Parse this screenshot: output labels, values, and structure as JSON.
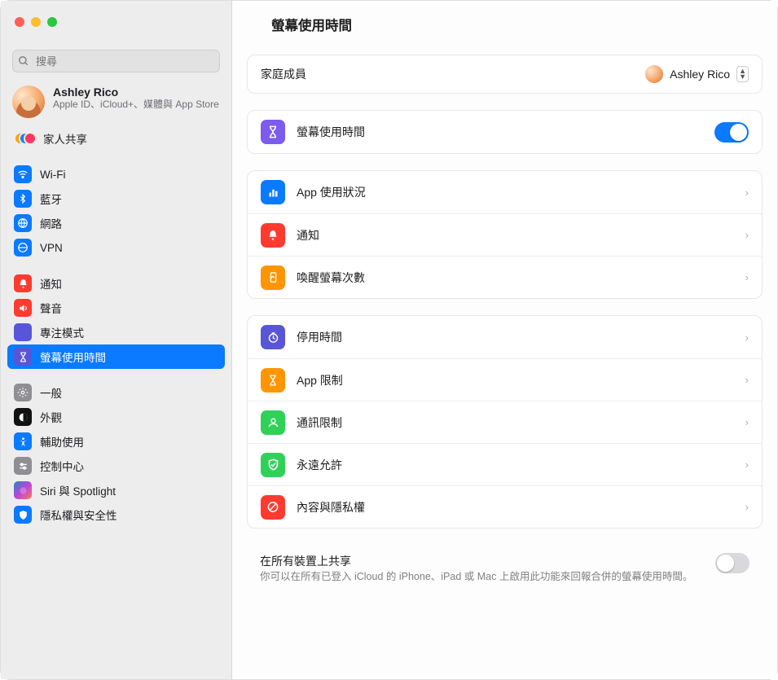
{
  "window": {
    "title": "螢幕使用時間"
  },
  "search": {
    "placeholder": "搜尋"
  },
  "user": {
    "name": "Ashley Rico",
    "sub": "Apple ID、iCloud+、媒體與 App Store"
  },
  "sidebar": {
    "family": "家人共享",
    "group1": [
      {
        "icon": "wifi-icon",
        "label": "Wi-Fi",
        "color": "bg-blue"
      },
      {
        "icon": "bluetooth-icon",
        "label": "藍牙",
        "color": "bg-blue"
      },
      {
        "icon": "network-icon",
        "label": "網路",
        "color": "bg-blue"
      },
      {
        "icon": "vpn-icon",
        "label": "VPN",
        "color": "bg-blue"
      }
    ],
    "group2": [
      {
        "icon": "bell-icon",
        "label": "通知",
        "color": "bg-red"
      },
      {
        "icon": "sound-icon",
        "label": "聲音",
        "color": "bg-red"
      },
      {
        "icon": "focus-icon",
        "label": "專注模式",
        "color": "bg-indigo"
      },
      {
        "icon": "screentime-icon",
        "label": "螢幕使用時間",
        "color": "bg-indigo",
        "selected": true
      }
    ],
    "group3": [
      {
        "icon": "gear-icon",
        "label": "一般",
        "color": "bg-gray"
      },
      {
        "icon": "appearance-icon",
        "label": "外觀",
        "color": ""
      },
      {
        "icon": "accessibility-icon",
        "label": "輔助使用",
        "color": "bg-blue"
      },
      {
        "icon": "control-center-icon",
        "label": "控制中心",
        "color": "bg-gray"
      },
      {
        "icon": "siri-icon",
        "label": "Siri 與 Spotlight",
        "color": ""
      },
      {
        "icon": "privacy-icon",
        "label": "隱私權與安全性",
        "color": "bg-blue"
      }
    ]
  },
  "main": {
    "family_member_label": "家庭成員",
    "family_member_value": "Ashley Rico",
    "screentime_toggle_label": "螢幕使用時間",
    "section_usage": [
      {
        "icon": "chart-icon",
        "label": "App 使用狀況",
        "color": "bg-blue"
      },
      {
        "icon": "bell-icon",
        "label": "通知",
        "color": "bg-red"
      },
      {
        "icon": "pickup-icon",
        "label": "喚醒螢幕次數",
        "color": "bg-orange"
      }
    ],
    "section_limits": [
      {
        "icon": "downtime-icon",
        "label": "停用時間",
        "color": "bg-indigo"
      },
      {
        "icon": "applimit-icon",
        "label": "App 限制",
        "color": "bg-orange"
      },
      {
        "icon": "comm-icon",
        "label": "通訊限制",
        "color": "bg-green"
      },
      {
        "icon": "allow-icon",
        "label": "永遠允許",
        "color": "bg-green"
      },
      {
        "icon": "restrict-icon",
        "label": "內容與隱私權",
        "color": "bg-red"
      }
    ],
    "share": {
      "title": "在所有裝置上共享",
      "desc": "你可以在所有已登入 iCloud 的 iPhone、iPad 或 Mac 上啟用此功能來回報合併的螢幕使用時間。"
    }
  }
}
